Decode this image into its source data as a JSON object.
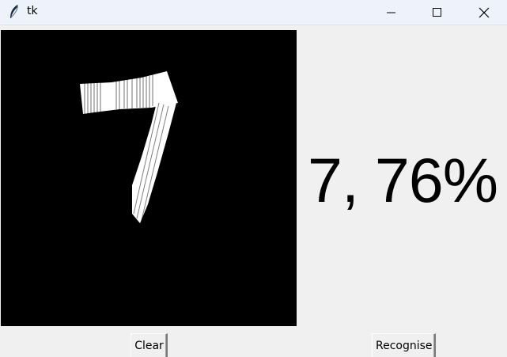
{
  "window": {
    "title": "tk"
  },
  "titlebar_icons": {
    "app": "feather-icon",
    "minimize": "minimize-icon",
    "maximize": "maximize-icon",
    "close": "close-icon"
  },
  "result": {
    "text": "7, 76%"
  },
  "buttons": {
    "clear_label": "Clear",
    "recognise_label": "Recognise"
  },
  "colors": {
    "canvas_bg": "#000000",
    "stroke": "#ffffff",
    "window_bg": "#f0f0f0",
    "titlebar_bg": "#eef2fa"
  }
}
